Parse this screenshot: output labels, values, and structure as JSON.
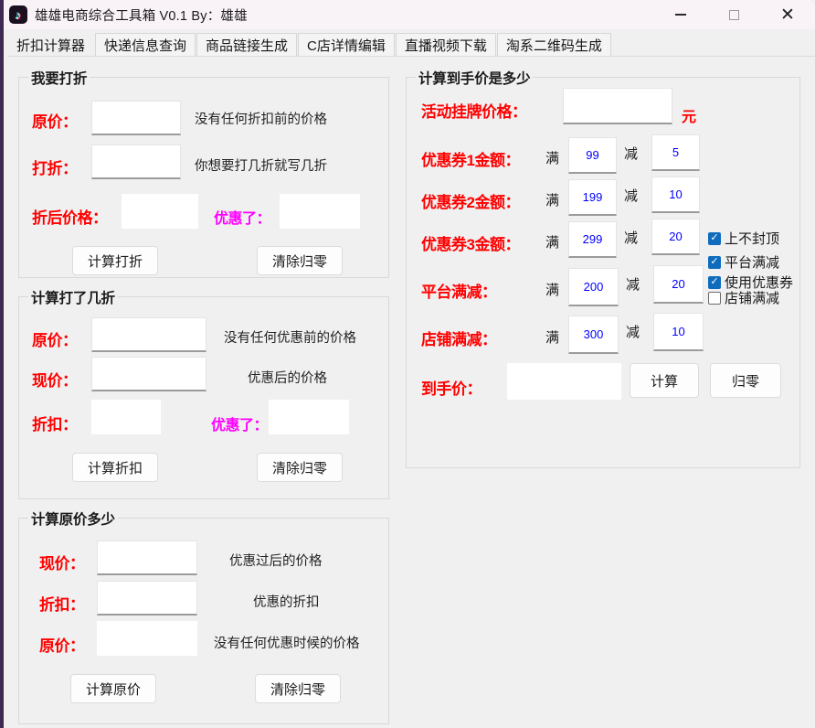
{
  "window": {
    "title": "雄雄电商综合工具箱 V0.1   By：雄雄",
    "icon": "music-note-icon",
    "minimize": "—",
    "maximize": "▢",
    "close": "✕",
    "accent_left_border": "#3d2a52",
    "titlebar_bg": "#f9f2f7"
  },
  "tabs": [
    {
      "label": "折扣计算器",
      "active": true
    },
    {
      "label": "快递信息查询",
      "active": false
    },
    {
      "label": "商品链接生成",
      "active": false
    },
    {
      "label": "C店详情编辑",
      "active": false
    },
    {
      "label": "直播视频下载",
      "active": false
    },
    {
      "label": "淘系二维码生成",
      "active": false
    }
  ],
  "colors": {
    "label_red": "#ff0000",
    "label_magenta": "#ff00ff",
    "value_blue": "#0000ff",
    "checkbox_blue": "#0f6cbd"
  },
  "groups": {
    "discount": {
      "legend": "我要打折",
      "fields": [
        {
          "label": "原价：",
          "value": "",
          "hint": "没有任何折扣前的价格"
        },
        {
          "label": "打折：",
          "value": "",
          "hint": "你想要打几折就写几折"
        }
      ],
      "result_label": "折后价格：",
      "result_value": "",
      "saved_label": "优惠了：",
      "saved_value": "",
      "buttons": [
        {
          "label": "计算打折"
        },
        {
          "label": "清除归零"
        }
      ]
    },
    "howmuch_off": {
      "legend": "计算打了几折",
      "fields": [
        {
          "label": "原价：",
          "value": "",
          "hint": "没有任何优惠前的价格"
        },
        {
          "label": "现价：",
          "value": "",
          "hint": "优惠后的价格"
        }
      ],
      "result_label": "折扣：",
      "result_value": "",
      "saved_label": "优惠了：",
      "saved_value": "",
      "buttons": [
        {
          "label": "计算折扣"
        },
        {
          "label": "清除归零"
        }
      ]
    },
    "original_price": {
      "legend": "计算原价多少",
      "fields": [
        {
          "label": "现价：",
          "value": "",
          "hint": "优惠过后的价格"
        },
        {
          "label": "折扣：",
          "value": "",
          "hint": "优惠的折扣"
        },
        {
          "label": "原价：",
          "value": "",
          "hint": "没有任何优惠时候的价格"
        }
      ],
      "buttons": [
        {
          "label": "计算原价"
        },
        {
          "label": "清除归零"
        }
      ]
    },
    "final_price": {
      "legend": "计算到手价是多少",
      "list_price_label": "活动挂牌价格：",
      "list_price_value": "",
      "list_price_unit": "元",
      "full_word": "满",
      "minus_word": "减",
      "rows": [
        {
          "label": "优惠券1金额：",
          "full": "99",
          "minus": "5"
        },
        {
          "label": "优惠券2金额：",
          "full": "199",
          "minus": "10"
        },
        {
          "label": "优惠券3金额：",
          "full": "299",
          "minus": "20"
        },
        {
          "label": "平台满减：",
          "full": "200",
          "minus": "20"
        },
        {
          "label": "店铺满减：",
          "full": "300",
          "minus": "10"
        }
      ],
      "checkboxes": [
        {
          "label": "使用优惠券",
          "checked": true
        },
        {
          "label": "上不封顶",
          "checked": true
        },
        {
          "label": "平台满减",
          "checked": true
        },
        {
          "label": "店铺满减",
          "checked": false
        }
      ],
      "final_label": "到手价：",
      "final_value": "",
      "buttons": [
        {
          "label": "计算"
        },
        {
          "label": "归零"
        }
      ]
    }
  }
}
